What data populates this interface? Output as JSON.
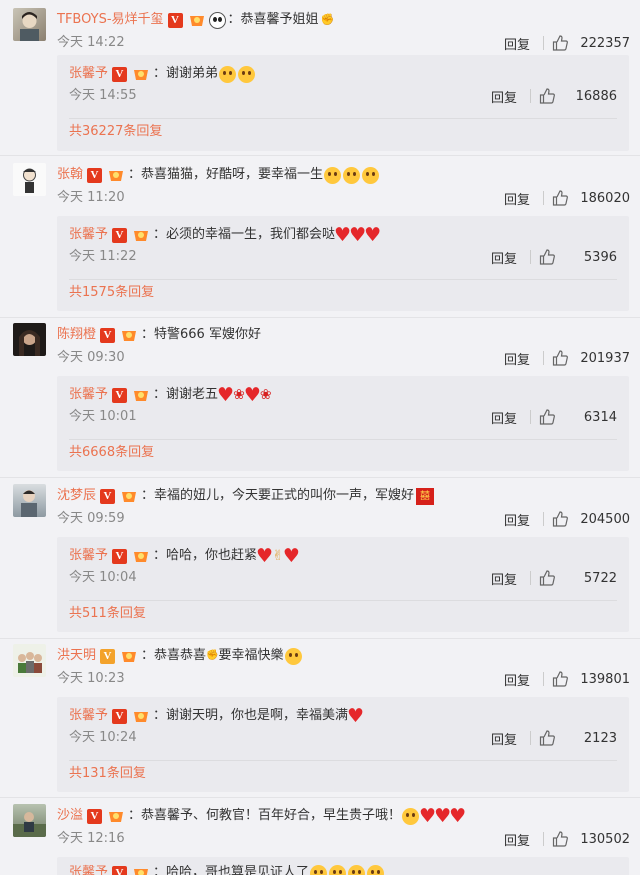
{
  "comments": [
    {
      "user": "TFBOYS-易烊千玺",
      "badge_color": "#e4391d",
      "text": "：恭喜馨予姐姐",
      "time": "今天 14:22",
      "reply_label": "回复",
      "likes": "222357",
      "sub": {
        "user": "张馨予",
        "text": "：谢谢弟弟",
        "time": "今天 14:55",
        "reply_label": "回复",
        "likes": "16886",
        "more": "共36227条回复"
      }
    },
    {
      "user": "张翰",
      "badge_color": "#e4391d",
      "text": "：恭喜猫猫，好酷呀，要幸福一生",
      "time": "今天 11:20",
      "reply_label": "回复",
      "likes": "186020",
      "sub": {
        "user": "张馨予",
        "text": "：必须的幸福一生，我们都会哒",
        "time": "今天 11:22",
        "reply_label": "回复",
        "likes": "5396",
        "more": "共1575条回复"
      }
    },
    {
      "user": "陈翔橙",
      "badge_color": "#e4391d",
      "text": "：特警666 军嫂你好",
      "time": "今天 09:30",
      "reply_label": "回复",
      "likes": "201937",
      "sub": {
        "user": "张馨予",
        "text": "：谢谢老五",
        "time": "今天 10:01",
        "reply_label": "回复",
        "likes": "6314",
        "more": "共6668条回复"
      }
    },
    {
      "user": "沈梦辰",
      "badge_color": "#e4391d",
      "text": "：幸福的妞儿，今天要正式的叫你一声，军嫂好",
      "time": "今天 09:59",
      "reply_label": "回复",
      "likes": "204500",
      "sub": {
        "user": "张馨予",
        "text": "：哈哈，你也赶紧",
        "time": "今天 10:04",
        "reply_label": "回复",
        "likes": "5722",
        "more": "共511条回复"
      }
    },
    {
      "user": "洪天明",
      "badge_color": "#f3a22b",
      "text": "：恭喜恭喜",
      "text2": "要幸福快樂",
      "time": "今天 10:23",
      "reply_label": "回复",
      "likes": "139801",
      "sub": {
        "user": "张馨予",
        "text": "：谢谢天明，你也是啊，幸福美满",
        "time": "今天 10:24",
        "reply_label": "回复",
        "likes": "2123",
        "more": "共131条回复"
      }
    },
    {
      "user": "沙溢",
      "badge_color": "#e4391d",
      "text": "：恭喜馨予、何教官！百年好合，早生贵子哦！",
      "time": "今天 12:16",
      "reply_label": "回复",
      "likes": "130502",
      "sub": {
        "user": "张馨予",
        "text": "：哈哈，哥也算是见证人了"
      }
    }
  ],
  "icons": {
    "like": "thumbs-up-icon",
    "verified": "verified-v-icon",
    "level": "member-level-icon"
  }
}
